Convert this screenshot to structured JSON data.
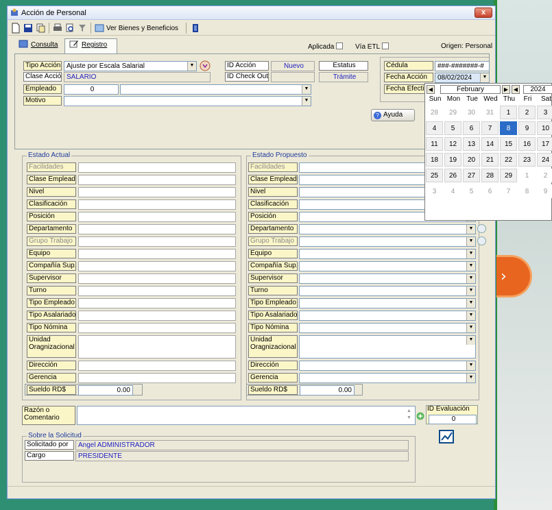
{
  "window": {
    "title": "Acción de Personal",
    "close_label": "x"
  },
  "toolbar": {
    "benefits_label": "Ver Bienes y Beneficios"
  },
  "tabs": {
    "consulta": "Consulta",
    "registro": "Registro"
  },
  "header": {
    "aplicada": "Aplicada",
    "via_etl": "Vía ETL",
    "origen": "Origen: Personal"
  },
  "form": {
    "tipo_accion_label": "Tipo Acción",
    "tipo_accion_value": "Ajuste por Escala Salarial",
    "clase_accion_label": "Clase Acción",
    "clase_accion_value": "SALARIO",
    "empleado_label": "Empleado",
    "empleado_value": "0",
    "motivo_label": "Motivo",
    "id_accion_label": "ID Acción",
    "id_accion_value": "Nuevo",
    "id_checkout_label": "ID Check Out",
    "estatus_label": "Estatus",
    "estatus_value": "Trámite",
    "cedula_label": "Cédula",
    "cedula_value": "###-#######-#",
    "fecha_accion_label": "Fecha Acción",
    "fecha_accion_value": "08/02/2024",
    "fecha_efectiva_label": "Fecha Efectiva",
    "ayuda_label": "Ayuda",
    "ayuda_icon": "?"
  },
  "estado_actual": {
    "title": "Estado Actual",
    "fields": [
      "Facilidades",
      "Clase Empleado",
      "Nivel",
      "Clasificación",
      "Posición",
      "Departamento",
      "Grupo Trabajo",
      "Equipo",
      "Compañía Sup.",
      "Supervisor",
      "Turno",
      "Tipo Empleado",
      "Tipo Asalariado",
      "Tipo Nómina",
      "Unidad Oragnizacional",
      "Dirección",
      "Gerencia"
    ],
    "sueldo_label": "Sueldo RD$",
    "sueldo_value": "0.00"
  },
  "estado_propuesto": {
    "title": "Estado Propuesto",
    "fields": [
      "Facilidades",
      "Clase Empleado",
      "Nivel",
      "Clasificación",
      "Posición",
      "Departamento",
      "Grupo Trabajo",
      "Equipo",
      "Compañía Sup.",
      "Supervisor",
      "Turno",
      "Tipo Empleado",
      "Tipo Asalariado",
      "Tipo Nómina",
      "Unidad Oragnizacional",
      "Dirección",
      "Gerencia"
    ],
    "sueldo_label": "Sueldo RD$",
    "sueldo_value": "0.00"
  },
  "comentario": {
    "label": "Razón o Comentario"
  },
  "evaluacion": {
    "label": "ID Evaluación",
    "value": "0"
  },
  "solicitud": {
    "title": "Sobre la Solicitud",
    "solicitado_label": "Solicitado por",
    "solicitado_value": "Angel ADMINISTRADOR",
    "cargo_label": "Cargo",
    "cargo_value": "PRESIDENTE"
  },
  "calendar": {
    "month": "February",
    "year": "2024",
    "dows": [
      "Sun",
      "Mon",
      "Tue",
      "Wed",
      "Thu",
      "Fri",
      "Sat"
    ],
    "weeks": [
      [
        "28",
        "29",
        "30",
        "31",
        "1",
        "2",
        "3"
      ],
      [
        "4",
        "5",
        "6",
        "7",
        "8",
        "9",
        "10"
      ],
      [
        "11",
        "12",
        "13",
        "14",
        "15",
        "16",
        "17"
      ],
      [
        "18",
        "19",
        "20",
        "21",
        "22",
        "23",
        "24"
      ],
      [
        "25",
        "26",
        "27",
        "28",
        "29",
        "1",
        "2"
      ],
      [
        "3",
        "4",
        "5",
        "6",
        "7",
        "8",
        "9"
      ]
    ],
    "selected_day": "8"
  },
  "decor": {
    "arrow_glyph": "›"
  },
  "colors": {
    "accent_blue": "#2a6cc7",
    "label_yellow": "#fbf6c8",
    "brand_orange": "#e8651f"
  }
}
